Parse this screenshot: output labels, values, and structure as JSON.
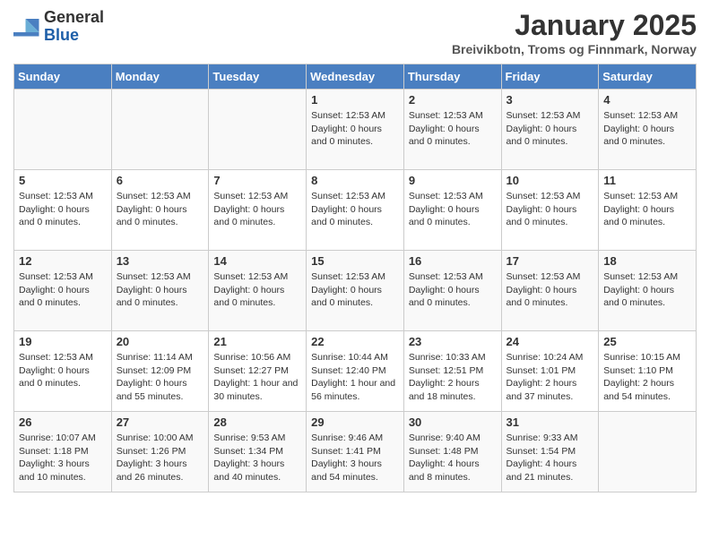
{
  "header": {
    "logo_general": "General",
    "logo_blue": "Blue",
    "month_title": "January 2025",
    "subtitle": "Breivikbotn, Troms og Finnmark, Norway"
  },
  "weekdays": [
    "Sunday",
    "Monday",
    "Tuesday",
    "Wednesday",
    "Thursday",
    "Friday",
    "Saturday"
  ],
  "weeks": [
    {
      "days": [
        {
          "num": "",
          "info": ""
        },
        {
          "num": "",
          "info": ""
        },
        {
          "num": "",
          "info": ""
        },
        {
          "num": "1",
          "info": "Sunset: 12:53 AM\nDaylight: 0 hours and 0 minutes."
        },
        {
          "num": "2",
          "info": "Sunset: 12:53 AM\nDaylight: 0 hours and 0 minutes."
        },
        {
          "num": "3",
          "info": "Sunset: 12:53 AM\nDaylight: 0 hours and 0 minutes."
        },
        {
          "num": "4",
          "info": "Sunset: 12:53 AM\nDaylight: 0 hours and 0 minutes."
        }
      ]
    },
    {
      "days": [
        {
          "num": "5",
          "info": "Sunset: 12:53 AM\nDaylight: 0 hours and 0 minutes."
        },
        {
          "num": "6",
          "info": "Sunset: 12:53 AM\nDaylight: 0 hours and 0 minutes."
        },
        {
          "num": "7",
          "info": "Sunset: 12:53 AM\nDaylight: 0 hours and 0 minutes."
        },
        {
          "num": "8",
          "info": "Sunset: 12:53 AM\nDaylight: 0 hours and 0 minutes."
        },
        {
          "num": "9",
          "info": "Sunset: 12:53 AM\nDaylight: 0 hours and 0 minutes."
        },
        {
          "num": "10",
          "info": "Sunset: 12:53 AM\nDaylight: 0 hours and 0 minutes."
        },
        {
          "num": "11",
          "info": "Sunset: 12:53 AM\nDaylight: 0 hours and 0 minutes."
        }
      ]
    },
    {
      "days": [
        {
          "num": "12",
          "info": "Sunset: 12:53 AM\nDaylight: 0 hours and 0 minutes."
        },
        {
          "num": "13",
          "info": "Sunset: 12:53 AM\nDaylight: 0 hours and 0 minutes."
        },
        {
          "num": "14",
          "info": "Sunset: 12:53 AM\nDaylight: 0 hours and 0 minutes."
        },
        {
          "num": "15",
          "info": "Sunset: 12:53 AM\nDaylight: 0 hours and 0 minutes."
        },
        {
          "num": "16",
          "info": "Sunset: 12:53 AM\nDaylight: 0 hours and 0 minutes."
        },
        {
          "num": "17",
          "info": "Sunset: 12:53 AM\nDaylight: 0 hours and 0 minutes."
        },
        {
          "num": "18",
          "info": "Sunset: 12:53 AM\nDaylight: 0 hours and 0 minutes."
        }
      ]
    },
    {
      "days": [
        {
          "num": "19",
          "info": "Sunset: 12:53 AM\nDaylight: 0 hours and 0 minutes."
        },
        {
          "num": "20",
          "info": "Sunrise: 11:14 AM\nSunset: 12:09 PM\nDaylight: 0 hours and 55 minutes."
        },
        {
          "num": "21",
          "info": "Sunrise: 10:56 AM\nSunset: 12:27 PM\nDaylight: 1 hour and 30 minutes."
        },
        {
          "num": "22",
          "info": "Sunrise: 10:44 AM\nSunset: 12:40 PM\nDaylight: 1 hour and 56 minutes."
        },
        {
          "num": "23",
          "info": "Sunrise: 10:33 AM\nSunset: 12:51 PM\nDaylight: 2 hours and 18 minutes."
        },
        {
          "num": "24",
          "info": "Sunrise: 10:24 AM\nSunset: 1:01 PM\nDaylight: 2 hours and 37 minutes."
        },
        {
          "num": "25",
          "info": "Sunrise: 10:15 AM\nSunset: 1:10 PM\nDaylight: 2 hours and 54 minutes."
        }
      ]
    },
    {
      "days": [
        {
          "num": "26",
          "info": "Sunrise: 10:07 AM\nSunset: 1:18 PM\nDaylight: 3 hours and 10 minutes."
        },
        {
          "num": "27",
          "info": "Sunrise: 10:00 AM\nSunset: 1:26 PM\nDaylight: 3 hours and 26 minutes."
        },
        {
          "num": "28",
          "info": "Sunrise: 9:53 AM\nSunset: 1:34 PM\nDaylight: 3 hours and 40 minutes."
        },
        {
          "num": "29",
          "info": "Sunrise: 9:46 AM\nSunset: 1:41 PM\nDaylight: 3 hours and 54 minutes."
        },
        {
          "num": "30",
          "info": "Sunrise: 9:40 AM\nSunset: 1:48 PM\nDaylight: 4 hours and 8 minutes."
        },
        {
          "num": "31",
          "info": "Sunrise: 9:33 AM\nSunset: 1:54 PM\nDaylight: 4 hours and 21 minutes."
        },
        {
          "num": "",
          "info": ""
        }
      ]
    }
  ]
}
